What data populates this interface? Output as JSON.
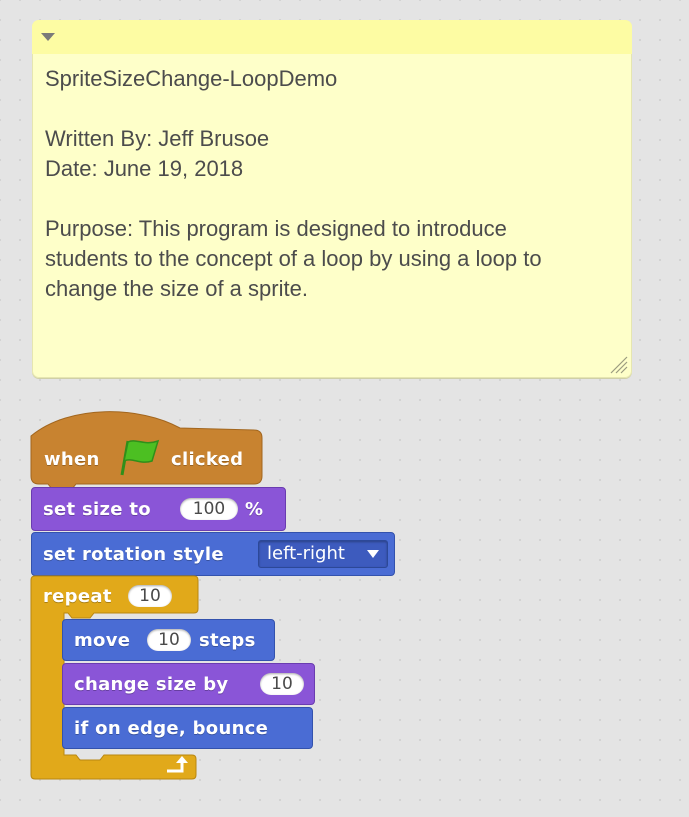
{
  "comment": {
    "title": "SpriteSizeChange-LoopDemo",
    "author_line": "Written By: Jeff Brusoe",
    "date_line": "Date: June 19, 2018",
    "purpose_line_1": "Purpose: This program is designed to introduce",
    "purpose_line_2": "students to the concept of a loop by using a loop to",
    "purpose_line_3": "change the size of a sprite."
  },
  "script": {
    "hat": {
      "when": "when",
      "clicked": "clicked",
      "icon": "green-flag-icon"
    },
    "set_size": {
      "label": "set size to",
      "value": "100",
      "unit": "%"
    },
    "set_rotation": {
      "label": "set rotation style",
      "value": "left-right"
    },
    "repeat": {
      "label": "repeat",
      "value": "10",
      "icon": "loop-arrow-icon"
    },
    "move": {
      "label_1": "move",
      "value": "10",
      "label_2": "steps"
    },
    "change_size": {
      "label": "change size by",
      "value": "10"
    },
    "bounce": {
      "label": "if on edge, bounce"
    }
  },
  "colors": {
    "events": "#c88330",
    "looks": "#8a55d7",
    "motion": "#4a6cd4",
    "control": "#e1a91a",
    "comment": "#feffc9"
  }
}
